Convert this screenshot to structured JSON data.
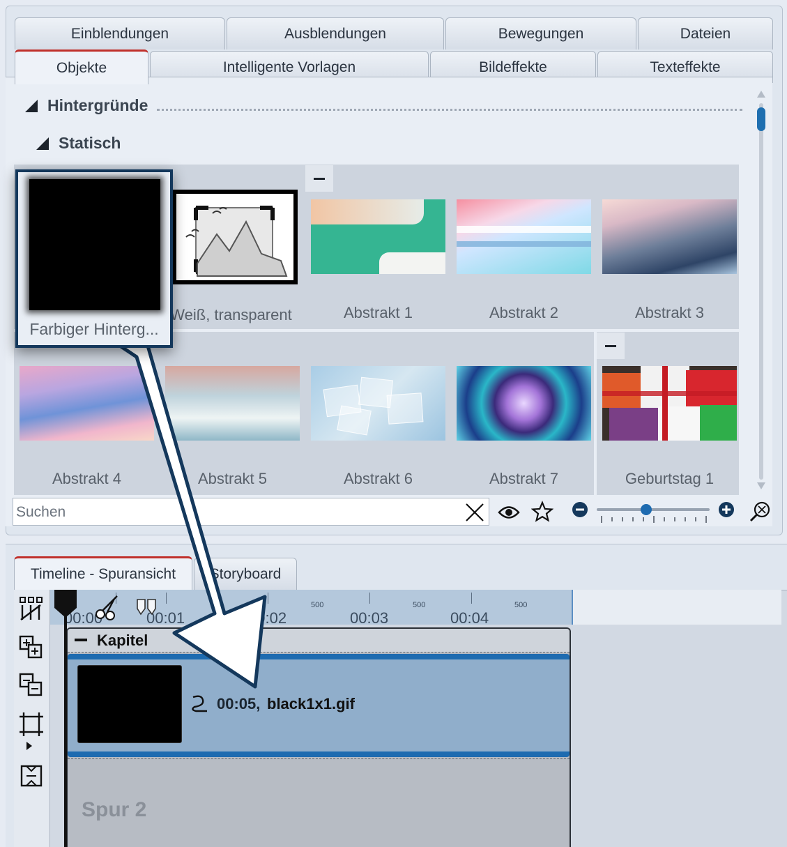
{
  "tabs_row1": [
    "Einblendungen",
    "Ausblendungen",
    "Bewegungen",
    "Dateien"
  ],
  "tabs_row2": [
    "Objekte",
    "Intelligente Vorlagen",
    "Bildeffekte",
    "Texteffekte"
  ],
  "active_tab": "Objekte",
  "groups": {
    "hintergruende": "Hintergründe",
    "statisch": "Statisch"
  },
  "tiles": {
    "weiss_transparent": "Weiß, transparent",
    "abstrakt1": "Abstrakt 1",
    "abstrakt2": "Abstrakt 2",
    "abstrakt3": "Abstrakt 3",
    "abstrakt4": "Abstrakt 4",
    "abstrakt5": "Abstrakt 5",
    "abstrakt6": "Abstrakt 6",
    "abstrakt7": "Abstrakt 7",
    "geburtstag1": "Geburtstag 1"
  },
  "drag_preview": {
    "label": "Farbiger Hinterg..."
  },
  "search": {
    "placeholder": "Suchen"
  },
  "zoom_level": 0.44,
  "bottom_tabs": {
    "timeline": "Timeline - Spuransicht",
    "storyboard": "Storyboard"
  },
  "ruler": {
    "timecodes": [
      "00:00",
      "00:01",
      "00:02",
      "00:03",
      "00:04"
    ],
    "sub_tick": "500"
  },
  "chapter": {
    "title": "Kapitel"
  },
  "clip": {
    "duration": "00:05,",
    "filename": "black1x1.gif"
  },
  "track2": {
    "label": "Spur 2"
  },
  "colors": {
    "accent": "#1e6bb0",
    "active_tab_border": "#c0302b",
    "arrow": "#14385c"
  }
}
